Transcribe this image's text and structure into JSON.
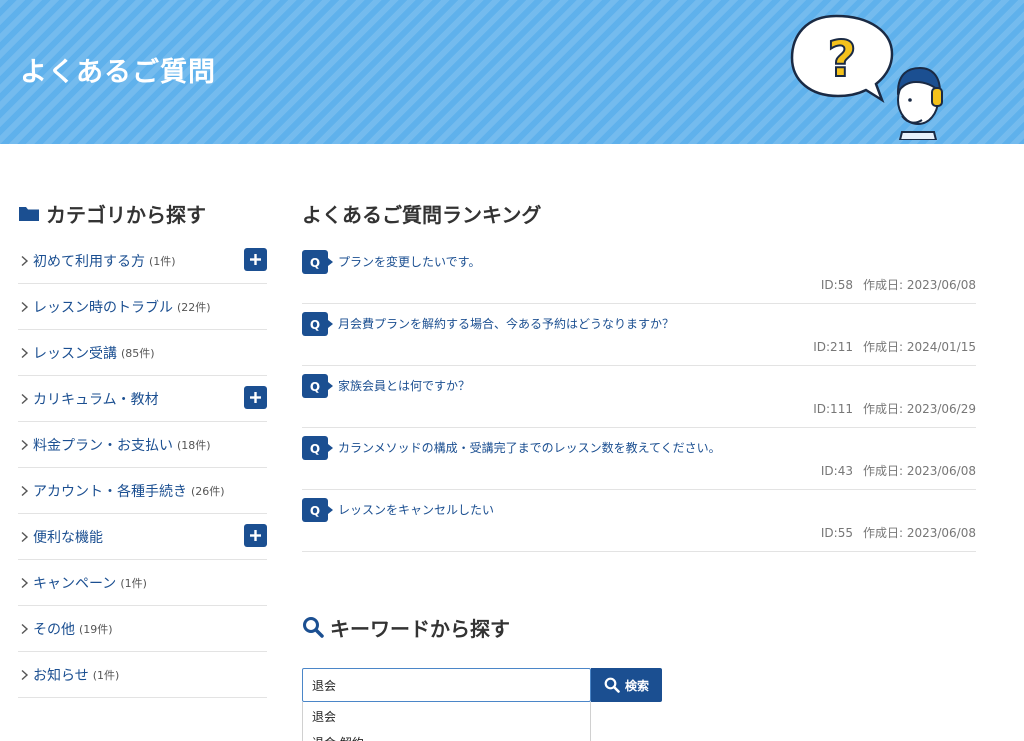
{
  "header": {
    "title": "よくあるご質問"
  },
  "sidebar": {
    "heading": "カテゴリから探す",
    "categories": [
      {
        "label": "初めて利用する方",
        "count": "(1件)",
        "expandable": true
      },
      {
        "label": "レッスン時のトラブル",
        "count": "(22件)",
        "expandable": false
      },
      {
        "label": "レッスン受講",
        "count": "(85件)",
        "expandable": false
      },
      {
        "label": "カリキュラム・教材",
        "count": "",
        "expandable": true
      },
      {
        "label": "料金プラン・お支払い",
        "count": "(18件)",
        "expandable": false
      },
      {
        "label": "アカウント・各種手続き",
        "count": "(26件)",
        "expandable": false
      },
      {
        "label": "便利な機能",
        "count": "",
        "expandable": true
      },
      {
        "label": "キャンペーン",
        "count": "(1件)",
        "expandable": false
      },
      {
        "label": "その他",
        "count": "(19件)",
        "expandable": false
      },
      {
        "label": "お知らせ",
        "count": "(1件)",
        "expandable": false
      }
    ]
  },
  "ranking": {
    "title": "よくあるご質問ランキング",
    "q_badge": "Q",
    "items": [
      {
        "question": "プランを変更したいです。",
        "id": "ID:58",
        "created": "作成日: 2023/06/08"
      },
      {
        "question": "月会費プランを解約する場合、今ある予約はどうなりますか？",
        "id": "ID:211",
        "created": "作成日: 2024/01/15"
      },
      {
        "question": "家族会員とは何ですか？",
        "id": "ID:111",
        "created": "作成日: 2023/06/29"
      },
      {
        "question": "カランメソッドの構成・受講完了までのレッスン数を教えてください。",
        "id": "ID:43",
        "created": "作成日: 2023/06/08"
      },
      {
        "question": "レッスンをキャンセルしたい",
        "id": "ID:55",
        "created": "作成日: 2023/06/08"
      }
    ]
  },
  "keyword": {
    "title": "キーワードから探す",
    "input_value": "退会",
    "button_label": "検索",
    "suggestions": [
      "退会",
      "退会 解約"
    ]
  },
  "colors": {
    "header_bg": "#5fb1ec",
    "accent": "#1b4f91",
    "link": "#1b4f91"
  },
  "icons": [
    "folder-icon",
    "chevron-right-icon",
    "plus-icon",
    "q-badge-icon",
    "search-icon",
    "question-bubble-icon",
    "support-agent-icon"
  ]
}
